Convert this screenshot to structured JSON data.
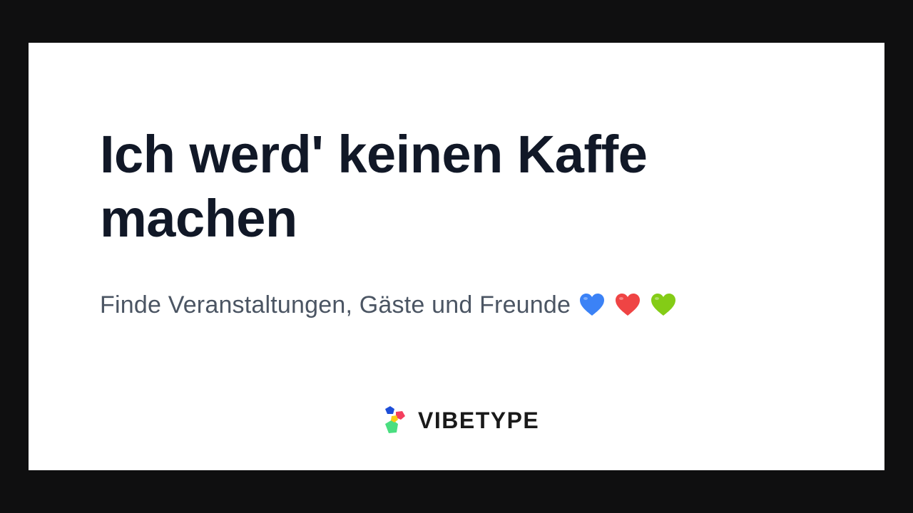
{
  "headline": "Ich werd' keinen Kaffe machen",
  "subtitle": "Finde Veranstaltungen, Gäste und Freunde",
  "hearts": [
    {
      "name": "blue-heart-icon",
      "color": "#3b82f6"
    },
    {
      "name": "red-heart-icon",
      "color": "#ef4444"
    },
    {
      "name": "green-heart-icon",
      "color": "#84cc16"
    }
  ],
  "brand": {
    "name": "VIBETYPE",
    "logo_colors": {
      "blue": "#1d4ed8",
      "pink": "#f43f5e",
      "yellow": "#facc15",
      "green": "#4ade80"
    }
  },
  "colors": {
    "page_background": "#0f0f10",
    "card_background": "#ffffff",
    "headline": "#111827",
    "subtitle": "#4b5563"
  }
}
